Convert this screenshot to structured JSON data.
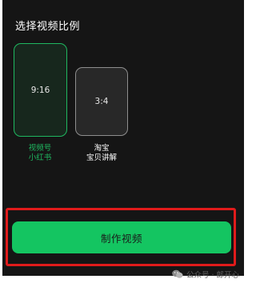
{
  "section": {
    "title": "选择视频比例"
  },
  "ratios": [
    {
      "label": "9:16",
      "caption_line1": "视频号",
      "caption_line2": "小红书",
      "selected": true
    },
    {
      "label": "3:4",
      "caption_line1": "淘宝",
      "caption_line2": "宝贝讲解",
      "selected": false
    }
  ],
  "action": {
    "make_video_label": "制作视频"
  },
  "watermark": {
    "text": "公众号 · 郎开心",
    "icon": "wechat-icon"
  },
  "colors": {
    "background": "#151515",
    "accent": "#14c561",
    "selected_border": "#1fb860",
    "highlight": "#e01b1b"
  }
}
